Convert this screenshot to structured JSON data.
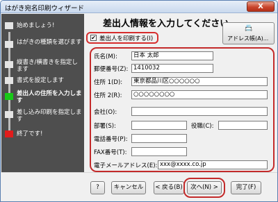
{
  "window": {
    "title": "はがき宛名印刷ウィザード",
    "close_label": "X"
  },
  "steps": [
    {
      "label": "始めましょう!",
      "state": "done"
    },
    {
      "label": "はがきの種類を選びます",
      "state": "done"
    },
    {
      "label": "縦書き/横書きを指定します",
      "state": "done"
    },
    {
      "label": "書式を設定します",
      "state": "done"
    },
    {
      "label": "差出人の住所を入力します",
      "state": "current"
    },
    {
      "label": "差し込み印刷を指定します",
      "state": "pending"
    },
    {
      "label": "終了です!",
      "state": "last"
    }
  ],
  "main": {
    "heading": "差出人情報を入力してください",
    "print_sender_label": "差出人を印刷する(I)",
    "print_sender_checked": "✔",
    "address_book_icon": "📇",
    "address_book_label": "アドレス帳(A)...",
    "fields": {
      "name_label": "氏名(M):",
      "name_value": "日本 太郎",
      "postal_label": "郵便番号(Z):",
      "postal_value": "1410032",
      "addr1_label": "住所 1(D):",
      "addr1_value": "東京都品川区○○○○○○",
      "addr2_label": "住所 2(R):",
      "addr2_value": "○○○○○○○○",
      "company_label": "会社(O):",
      "company_value": "",
      "dept_label": "部署(S):",
      "dept_value": "",
      "title_label": "役職(C):",
      "title_value": "",
      "phone_label": "電話番号(P):",
      "phone_value": "",
      "fax_label": "FAX番号(T):",
      "fax_value": "",
      "email_label": "電子メールアドレス(E):",
      "email_value": "xxx@xxxx.co.jp"
    }
  },
  "buttons": {
    "help": "?",
    "cancel": "キャンセル",
    "back": "< 戻る(B)",
    "next": "次へ(N) >",
    "finish": "完了(F)"
  },
  "colors": {
    "step_current": "#18c918",
    "step_last": "#e01c1c",
    "highlight_ring": "#c32a2a"
  }
}
